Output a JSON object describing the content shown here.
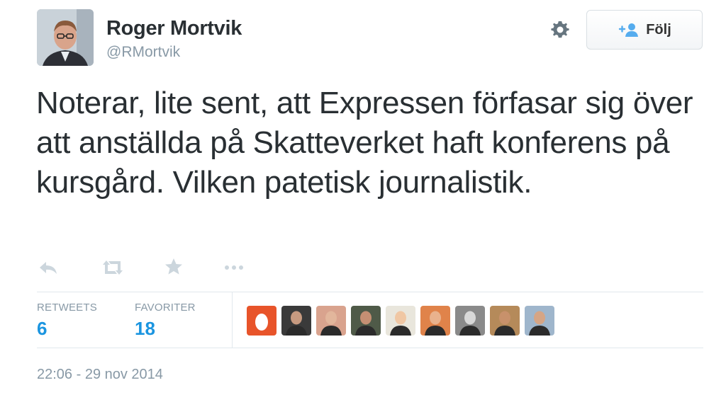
{
  "user": {
    "name": "Roger Mortvik",
    "handle": "@RMortvik"
  },
  "follow_button": {
    "label": "Följ"
  },
  "tweet": {
    "text": "Noterar, lite sent, att Expressen förfasar sig över att anställda på Skatteverket haft konferens på kursgård. Vilken patetisk journalistik."
  },
  "actions": [
    "reply-icon",
    "retweet-icon",
    "favorite-icon",
    "more-icon"
  ],
  "stats": {
    "retweets_label": "RETWEETS",
    "retweets_count": "6",
    "favorites_label": "FAVORITER",
    "favorites_count": "18"
  },
  "favoriters": [
    {
      "name": "favoriter-avatar-1",
      "bg": "#e8542a"
    },
    {
      "name": "favoriter-avatar-2",
      "bg": "#3a3a3a"
    },
    {
      "name": "favoriter-avatar-3",
      "bg": "#d9a38e"
    },
    {
      "name": "favoriter-avatar-4",
      "bg": "#4f5a48"
    },
    {
      "name": "favoriter-avatar-5",
      "bg": "#e9e6dc"
    },
    {
      "name": "favoriter-avatar-6",
      "bg": "#e0834a"
    },
    {
      "name": "favoriter-avatar-7",
      "bg": "#8a8a8a"
    },
    {
      "name": "favoriter-avatar-8",
      "bg": "#b58a5a"
    },
    {
      "name": "favoriter-avatar-9",
      "bg": "#9fb6cc"
    }
  ],
  "timestamp": "22:06 - 29 nov 2014",
  "colors": {
    "accent": "#1b95e0",
    "muted": "#8899a6",
    "text": "#292f33",
    "icon": "#ccd6dd"
  }
}
